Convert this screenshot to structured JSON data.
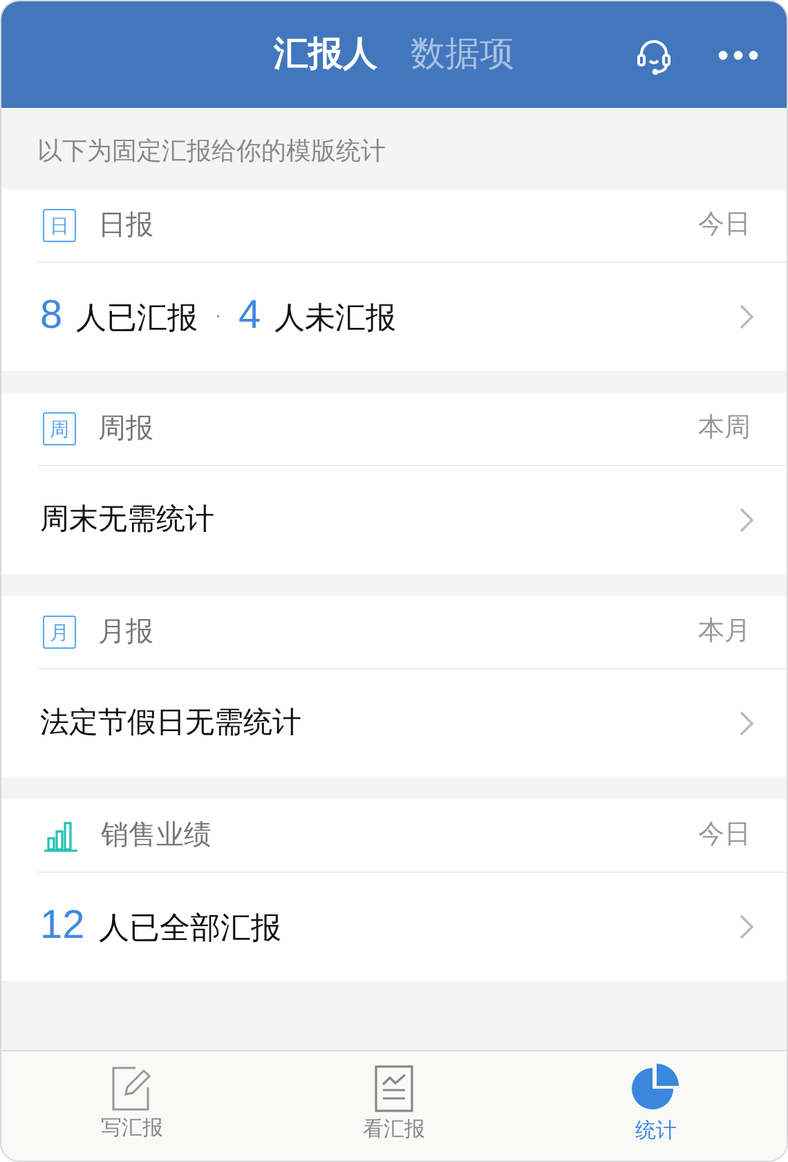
{
  "header": {
    "tabs": [
      {
        "label": "汇报人",
        "selected": true
      },
      {
        "label": "数据项",
        "selected": false
      }
    ]
  },
  "notice": "以下为固定汇报给你的模版统计",
  "cards": [
    {
      "icon": {
        "kind": "calendar",
        "char": "日"
      },
      "title": "日报",
      "period": "今日",
      "body": {
        "kind": "counts",
        "separator": "·",
        "items": [
          {
            "count": "8",
            "label": "人已汇报"
          },
          {
            "count": "4",
            "label": "人未汇报"
          }
        ]
      }
    },
    {
      "icon": {
        "kind": "calendar",
        "char": "周"
      },
      "title": "周报",
      "period": "本周",
      "body": {
        "kind": "text",
        "text": "周末无需统计"
      }
    },
    {
      "icon": {
        "kind": "calendar",
        "char": "月"
      },
      "title": "月报",
      "period": "本月",
      "body": {
        "kind": "text",
        "text": "法定节假日无需统计"
      }
    },
    {
      "icon": {
        "kind": "bars"
      },
      "title": "销售业绩",
      "period": "今日",
      "body": {
        "kind": "counts",
        "items": [
          {
            "count": "12",
            "label": "人已全部汇报"
          }
        ]
      }
    }
  ],
  "bottom_tabs": [
    {
      "label": "写汇报",
      "kind": "pencil",
      "selected": false
    },
    {
      "label": "看汇报",
      "kind": "document",
      "selected": false
    },
    {
      "label": "统计",
      "kind": "pie",
      "selected": true
    }
  ]
}
